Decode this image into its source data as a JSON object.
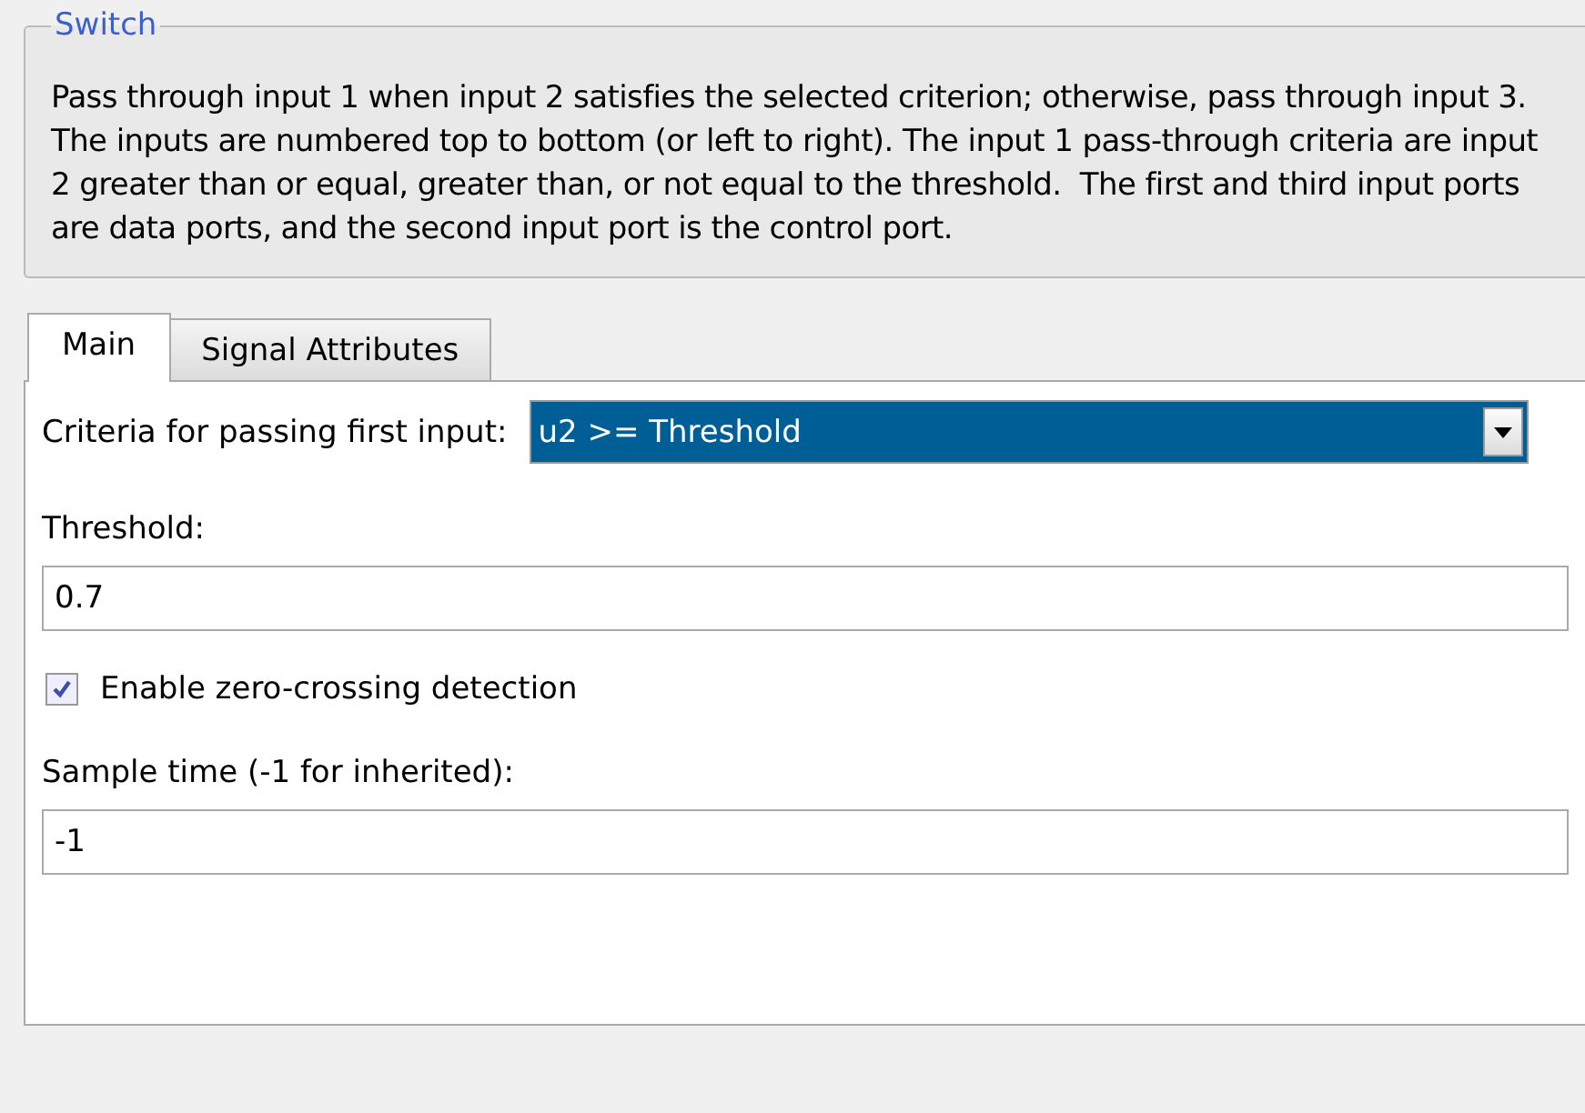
{
  "group": {
    "title": "Switch",
    "description": "Pass through input 1 when input 2 satisfies the selected criterion; otherwise, pass through input 3.  The inputs are numbered top to bottom (or left to right). The input 1 pass-through criteria are input 2 greater than or equal, greater than, or not equal to the threshold.  The first and third input ports are data ports, and the second input port is the control port."
  },
  "tabs": [
    {
      "label": "Main",
      "selected": true
    },
    {
      "label": "Signal Attributes",
      "selected": false
    }
  ],
  "params": [
    {
      "kind": "dropdown",
      "label": "Criteria for passing first input:",
      "value": "u2 >= Threshold"
    },
    {
      "kind": "text",
      "label": "Threshold:",
      "value": "0.7"
    },
    {
      "kind": "checkbox",
      "label": "Enable zero-crossing detection",
      "checked": true
    },
    {
      "kind": "text",
      "label": "Sample time (-1 for inherited):",
      "value": "-1"
    }
  ]
}
